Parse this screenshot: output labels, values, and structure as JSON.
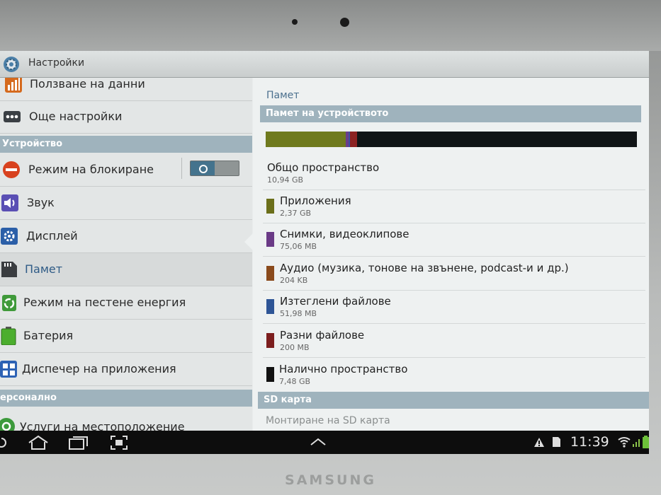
{
  "device": {
    "brand": "SAMSUNG"
  },
  "actionbar": {
    "title": "Настройки",
    "icon": "settings-gear-icon"
  },
  "left": {
    "items_top": [
      {
        "label": "Ползване на данни",
        "icon": "data-usage-icon"
      },
      {
        "label": "Още настройки",
        "icon": "more-dots-icon"
      }
    ],
    "header_device": "Устройство",
    "items_device": [
      {
        "label": "Режим на блокиране",
        "icon": "block-icon"
      },
      {
        "label": "Звук",
        "icon": "speaker-icon"
      },
      {
        "label": "Дисплей",
        "icon": "display-gear-icon"
      },
      {
        "label": "Памет",
        "icon": "sd-card-icon"
      },
      {
        "label": "Режим на пестене енергия",
        "icon": "recycle-icon"
      },
      {
        "label": "Батерия",
        "icon": "battery-icon"
      },
      {
        "label": "Диспечер на приложения",
        "icon": "app-grid-icon"
      }
    ],
    "header_personal": "ерсонално",
    "items_personal": [
      {
        "label": "Услуги на местоположение",
        "icon": "location-icon"
      }
    ]
  },
  "right": {
    "title": "Памет",
    "header_device_storage": "Памет на устройството",
    "usage_fractions": [
      {
        "color": "#6f7a1e",
        "fraction": 0.216
      },
      {
        "color": "#6a3e8a",
        "fraction": 0.007
      },
      {
        "color": "#3a4fa0",
        "fraction": 0.005
      },
      {
        "color": "#8c2222",
        "fraction": 0.018
      },
      {
        "color": "#101416",
        "fraction": 0.684
      }
    ],
    "total": {
      "name": "Общо пространство",
      "size": "10,94 GB"
    },
    "rows": [
      {
        "name": "Приложения",
        "size": "2,37 GB",
        "color": "#6b6f1a"
      },
      {
        "name": "Снимки, видеоклипове",
        "size": "75,06 MB",
        "color": "#6a3a86"
      },
      {
        "name": "Аудио (музика, тонове на звънене, podcast-и и др.)",
        "size": "204 KB",
        "color": "#8a4a1c"
      },
      {
        "name": "Изтеглени файлове",
        "size": "51,98 MB",
        "color": "#2e5596"
      },
      {
        "name": "Разни файлове",
        "size": "200 MB",
        "color": "#7c1e1e"
      },
      {
        "name": "Налично пространство",
        "size": "7,48 GB",
        "color": "#111111"
      }
    ],
    "header_sd": "SD карта",
    "sd_mount": "Монтиране на SD карта"
  },
  "navbar": {
    "time": "11:39"
  }
}
